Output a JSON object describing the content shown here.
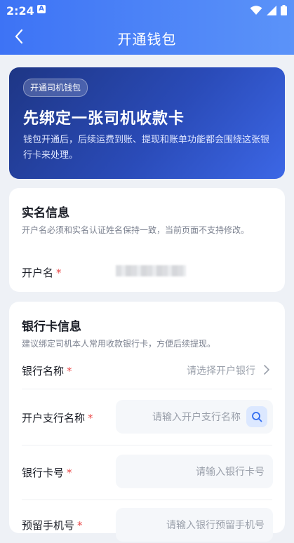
{
  "status_bar": {
    "time": "2:24",
    "badge": "A"
  },
  "nav": {
    "title": "开通钱包"
  },
  "hero": {
    "chip": "开通司机钱包",
    "title": "先绑定一张司机收款卡",
    "desc": "钱包开通后，后续运费到账、提现和账单功能都会围绕这张银行卡来处理。"
  },
  "realname": {
    "title": "实名信息",
    "desc": "开户名必须和实名认证姓名保持一致，当前页面不支持修改。",
    "account_name_label": "开户名",
    "required_mark": "*"
  },
  "bank": {
    "title": "银行卡信息",
    "desc": "建议绑定司机本人常用收款银行卡，方便后续提现。",
    "bank_name_label": "银行名称",
    "bank_name_placeholder": "请选择开户银行",
    "branch_label": "开户支行名称",
    "branch_placeholder": "请输入开户支行名称",
    "card_no_label": "银行卡号",
    "card_no_placeholder": "请输入银行卡号",
    "phone_label": "预留手机号",
    "phone_placeholder": "请输入银行预留手机号",
    "required_mark": "*"
  },
  "colors": {
    "primary": "#3d73f5",
    "required": "#ea4a4a"
  }
}
